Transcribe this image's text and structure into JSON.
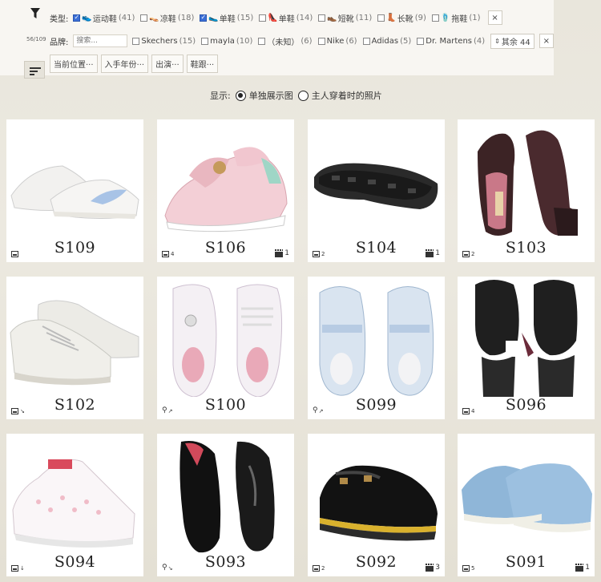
{
  "filter": {
    "count": "56/109",
    "type_label": "类型:",
    "types": [
      {
        "glyph": "👟",
        "label": "运动鞋",
        "count": "(41)",
        "checked": true
      },
      {
        "glyph": "👡",
        "label": "凉鞋",
        "count": "(18)",
        "checked": false
      },
      {
        "glyph": "🥿",
        "label": "单鞋",
        "count": "(15)",
        "checked": true
      },
      {
        "glyph": "👠",
        "label": "单鞋",
        "count": "(14)",
        "checked": false
      },
      {
        "glyph": "👞",
        "label": "短靴",
        "count": "(11)",
        "checked": false
      },
      {
        "glyph": "👢",
        "label": "长靴",
        "count": "(9)",
        "checked": false
      },
      {
        "glyph": "🩴",
        "label": "拖鞋",
        "count": "(1)",
        "checked": false
      }
    ],
    "brand_label": "品牌:",
    "brand_search_placeholder": "搜索...",
    "brands": [
      {
        "label": "Skechers",
        "count": "(15)"
      },
      {
        "label": "mayla",
        "count": "(10)"
      },
      {
        "label": "（未知）",
        "count": "(6)"
      },
      {
        "label": "Nike",
        "count": "(6)"
      },
      {
        "label": "Adidas",
        "count": "(5)"
      },
      {
        "label": "Dr. Martens",
        "count": "(4)"
      }
    ],
    "brand_rest_label": "其余 44",
    "clear_glyph": "×",
    "tags": [
      "当前位置···",
      "入手年份···",
      "出演···",
      "鞋跟···"
    ]
  },
  "display": {
    "label": "显示:",
    "options": [
      {
        "label": "单独展示图",
        "selected": true
      },
      {
        "label": "主人穿着时的照片",
        "selected": false
      }
    ]
  },
  "cards": [
    {
      "code": "S109",
      "pics": "",
      "video": ""
    },
    {
      "code": "S106",
      "pics": "4",
      "video": "1"
    },
    {
      "code": "S104",
      "pics": "2",
      "video": "1"
    },
    {
      "code": "S103",
      "pics": "2",
      "video": ""
    },
    {
      "code": "S102",
      "pics": "",
      "video": ""
    },
    {
      "code": "S100",
      "pics": "",
      "video": ""
    },
    {
      "code": "S099",
      "pics": "",
      "video": ""
    },
    {
      "code": "S096",
      "pics": "4",
      "video": ""
    },
    {
      "code": "S094",
      "pics": "",
      "video": ""
    },
    {
      "code": "S093",
      "pics": "",
      "video": ""
    },
    {
      "code": "S092",
      "pics": "2",
      "video": "3"
    },
    {
      "code": "S091",
      "pics": "5",
      "video": "1"
    }
  ],
  "colors": {
    "checkbox_on": "#3b6fd6",
    "background": "#e9e6dc",
    "card": "#ffffff"
  }
}
